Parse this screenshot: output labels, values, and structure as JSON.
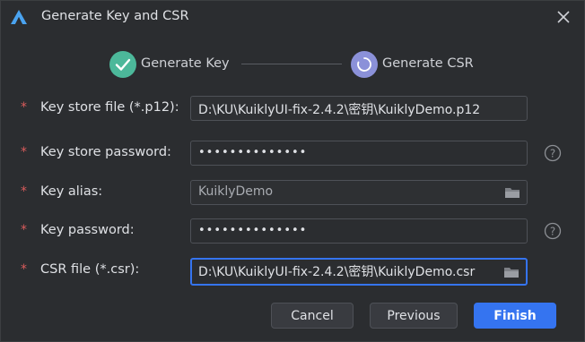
{
  "window": {
    "title": "Generate Key and CSR",
    "logo_icon": "harmony-logo-icon",
    "close_icon": "close-icon"
  },
  "steps": [
    {
      "label": "Generate Key",
      "state": "completed",
      "icon": "check-icon",
      "color": "#4cb89a"
    },
    {
      "label": "Generate CSR",
      "state": "active",
      "icon": "refresh-icon",
      "color": "#8b91d9"
    }
  ],
  "form": {
    "required_marker": "*",
    "key_store_file": {
      "label": "Key store file (*.p12):",
      "value": "D:\\KU\\KuiklyUI-fix-2.4.2\\密钥\\KuiklyDemo.p12"
    },
    "key_store_password": {
      "label": "Key store password:",
      "value": "••••••••••••••",
      "help_icon": "help-icon"
    },
    "key_alias": {
      "label": "Key alias:",
      "value": "KuiklyDemo",
      "icon": "folder-icon"
    },
    "key_password": {
      "label": "Key password:",
      "value": "••••••••••••••",
      "help_icon": "help-icon"
    },
    "csr_file": {
      "label": "CSR file (*.csr):",
      "value": "D:\\KU\\KuiklyUI-fix-2.4.2\\密钥\\KuiklyDemo.csr",
      "icon": "folder-icon"
    }
  },
  "buttons": {
    "cancel": "Cancel",
    "previous": "Previous",
    "finish": "Finish"
  },
  "colors": {
    "background": "#2b2d30",
    "accent": "#3574f0",
    "required": "#db5c5c"
  }
}
